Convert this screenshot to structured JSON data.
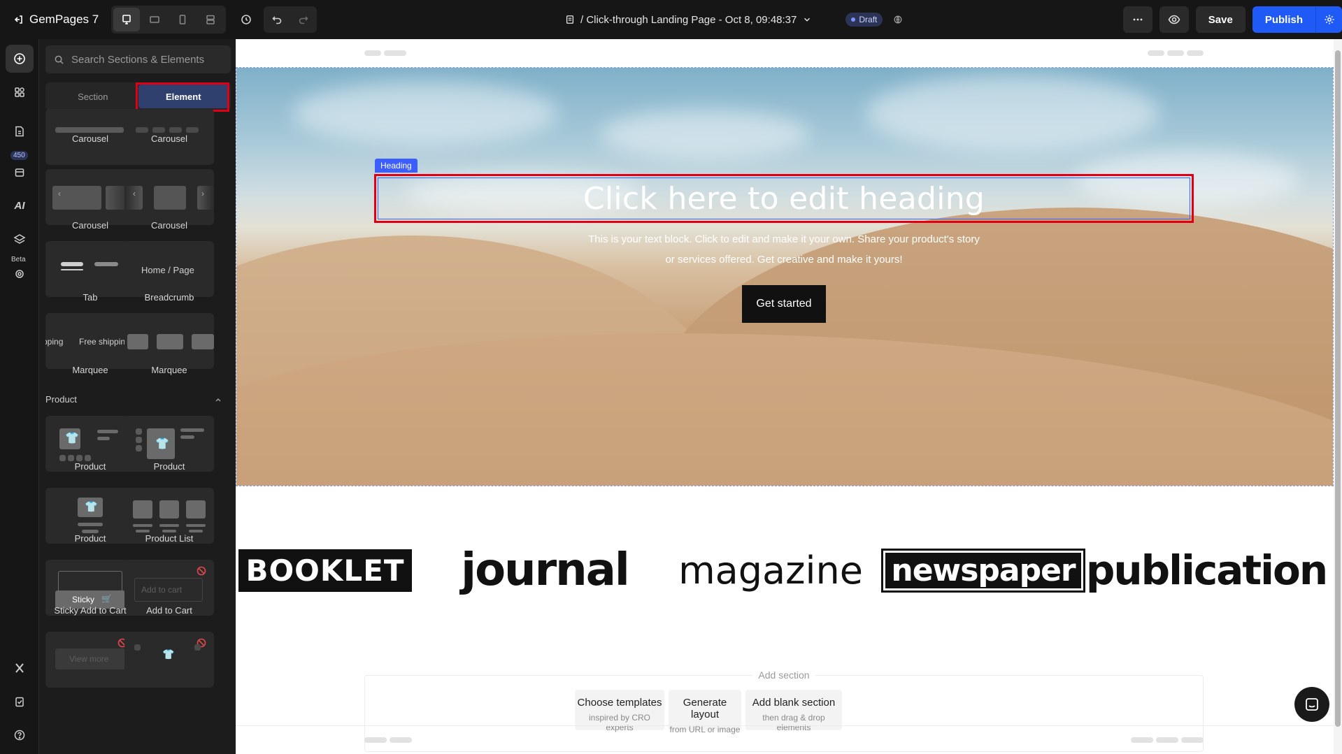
{
  "topbar": {
    "brand": "GemPages 7",
    "page_title": "/ Click-through Landing Page - Oct 8, 09:48:37",
    "status": "Draft",
    "save_label": "Save",
    "publish_label": "Publish"
  },
  "rail": {
    "badge_count": "450",
    "beta_label": "Beta",
    "ai_label": "AI"
  },
  "panel": {
    "search_placeholder": "Search Sections & Elements",
    "tabs": {
      "section": "Section",
      "element": "Element"
    },
    "tiles": {
      "carousel_1": "Carousel",
      "carousel_2": "Carousel",
      "carousel_3": "Carousel",
      "carousel_4": "Carousel",
      "tab": "Tab",
      "breadcrumb": "Breadcrumb",
      "breadcrumb_preview": "Home  /  Page",
      "marquee_1": "Marquee",
      "marquee_preview": "Free shipping",
      "marquee_preview_left": "pping",
      "marquee_2": "Marquee",
      "product_section": "Product",
      "product_1": "Product",
      "product_2": "Product",
      "product_3": "Product",
      "product_list": "Product List",
      "sticky_add_to_cart": "Sticky Add to Cart",
      "sticky_preview": "Sticky",
      "add_to_cart": "Add to Cart",
      "add_to_cart_preview": "Add to cart",
      "view_more_preview": "View more"
    }
  },
  "canvas": {
    "heading_tag": "Heading",
    "heading": "Click here to edit heading",
    "body_line1": "This is your text block. Click to edit and make it your own. Share your product's story",
    "body_line2": "or services offered. Get creative and make it yours!",
    "cta": "Get started",
    "logos": {
      "booklet": "BOOKLET",
      "journal": "journal",
      "magazine": "magazine",
      "newspaper": "newspaper",
      "publication": "publication"
    },
    "add_section": {
      "title": "Add section",
      "choose_templates": "Choose templates",
      "choose_templates_sub": "inspired by CRO experts",
      "generate_layout": "Generate layout",
      "generate_layout_sub": "from URL or image",
      "add_blank": "Add blank section",
      "add_blank_sub": "then drag & drop elements"
    }
  }
}
